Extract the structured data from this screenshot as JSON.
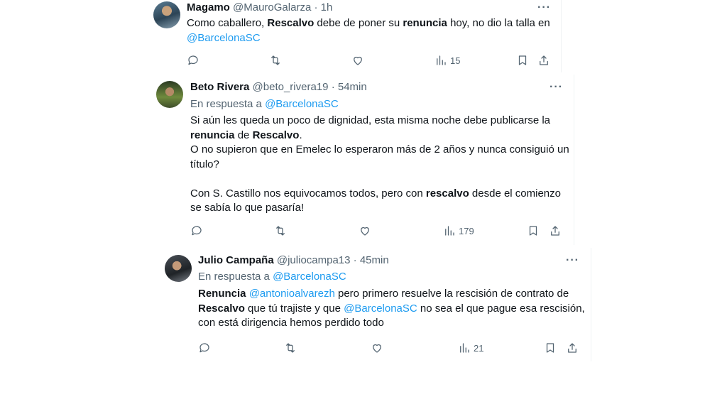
{
  "tweets": [
    {
      "name": "Magamo",
      "handle": "@MauroGalarza",
      "time": "· 1h",
      "body": [
        {
          "t": "Como caballero, "
        },
        {
          "t": "Rescalvo",
          "b": true
        },
        {
          "t": " debe de poner su "
        },
        {
          "t": "renuncia",
          "b": true
        },
        {
          "t": " hoy, no dio la talla en "
        },
        {
          "t": "@BarcelonaSC",
          "link": true
        }
      ],
      "views": "15",
      "avatar": "avatar-magamo"
    },
    {
      "name": "Beto Rivera",
      "handle": "@beto_rivera19",
      "time": "· 54min",
      "reply_prefix": "En respuesta a",
      "reply_to": "@BarcelonaSC",
      "body": [
        {
          "t": "Si aún les queda un poco de dignidad, esta misma noche debe publicarse la "
        },
        {
          "t": "renuncia",
          "b": true
        },
        {
          "t": " de "
        },
        {
          "t": "Rescalvo",
          "b": true
        },
        {
          "t": "."
        },
        {
          "br": 1
        },
        {
          "t": "O no supieron que en Emelec lo esperaron más de 2 años y nunca consiguió un título?"
        },
        {
          "br": 2
        },
        {
          "t": "Con S. Castillo nos equivocamos todos, pero con "
        },
        {
          "t": "rescalvo",
          "b": true
        },
        {
          "t": " desde el comienzo se sabía lo que pasaría!"
        }
      ],
      "views": "179",
      "avatar": "avatar-beto"
    },
    {
      "name": "Julio Campaña",
      "handle": "@juliocampa13",
      "time": "· 45min",
      "reply_prefix": "En respuesta a",
      "reply_to": "@BarcelonaSC",
      "body": [
        {
          "t": "Renuncia",
          "b": true
        },
        {
          "t": " "
        },
        {
          "t": "@antonioalvarezh",
          "link": true
        },
        {
          "t": " pero primero resuelve la rescisión de contrato de "
        },
        {
          "t": "Rescalvo",
          "b": true
        },
        {
          "t": " que tú trajiste y que "
        },
        {
          "t": "@BarcelonaSC",
          "link": true
        },
        {
          "t": " no sea el que pague esa rescisión, con está dirigencia hemos perdido todo"
        }
      ],
      "views": "21",
      "avatar": "avatar-julio"
    }
  ],
  "more_label": "···",
  "icons": [
    "reply-icon",
    "retweet-icon",
    "like-icon",
    "views-icon",
    "bookmark-icon",
    "share-icon",
    "more-icon"
  ]
}
